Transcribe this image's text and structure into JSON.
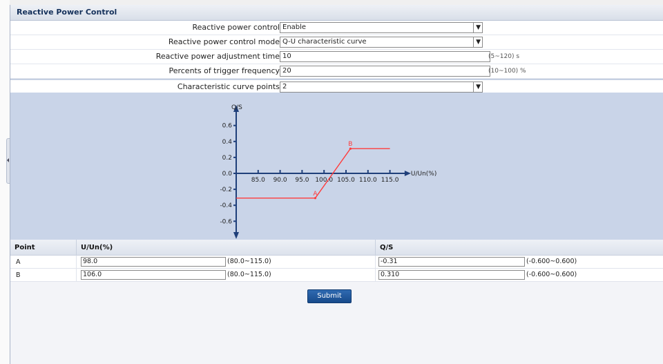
{
  "section": {
    "title": "Reactive Power Control"
  },
  "form": {
    "rows": [
      {
        "label": "Reactive power control",
        "value": "Enable",
        "type": "select",
        "hint": ""
      },
      {
        "label": "Reactive power control mode",
        "value": "Q-U characteristic curve",
        "type": "select",
        "hint": ""
      },
      {
        "label": "Reactive power adjustment time",
        "value": "10",
        "type": "text",
        "hint": "(5~120) s"
      },
      {
        "label": "Percents of trigger frequency",
        "value": "20",
        "type": "text",
        "hint": "(10~100) %"
      },
      {
        "label": "Characteristic curve points",
        "value": "2",
        "type": "select",
        "hint": ""
      }
    ]
  },
  "chart_data": {
    "type": "line",
    "ylabel": "Q/S",
    "xlabel": "U/Un(%)",
    "xticks": [
      "85.0",
      "90.0",
      "95.0",
      "100.0",
      "105.0",
      "110.0",
      "115.0"
    ],
    "yticks": [
      "0.6",
      "0.4",
      "0.2",
      "0.0",
      "-0.2",
      "-0.4",
      "-0.6"
    ],
    "xlim": [
      80,
      115
    ],
    "ylim": [
      -0.6,
      0.6
    ],
    "series": [
      {
        "points": [
          [
            80,
            -0.31
          ],
          [
            98,
            -0.31
          ],
          [
            106,
            0.31
          ],
          [
            115,
            0.31
          ]
        ],
        "color": "#ff3b3b"
      }
    ],
    "annotations": [
      {
        "label": "A",
        "x": 98,
        "y": -0.31
      },
      {
        "label": "B",
        "x": 106,
        "y": 0.31
      }
    ],
    "axis_color": "#1f3f7a",
    "grid": false
  },
  "points_table": {
    "headers": [
      "Point",
      "U/Un(%)",
      "Q/S"
    ],
    "rows": [
      {
        "point": "A",
        "u": "98.0",
        "u_range": "(80.0~115.0)",
        "q": "-0.31",
        "q_range": "(-0.600~0.600)"
      },
      {
        "point": "B",
        "u": "106.0",
        "u_range": "(80.0~115.0)",
        "q": "0.310",
        "q_range": "(-0.600~0.600)"
      }
    ]
  },
  "submit": {
    "label": "Submit"
  }
}
